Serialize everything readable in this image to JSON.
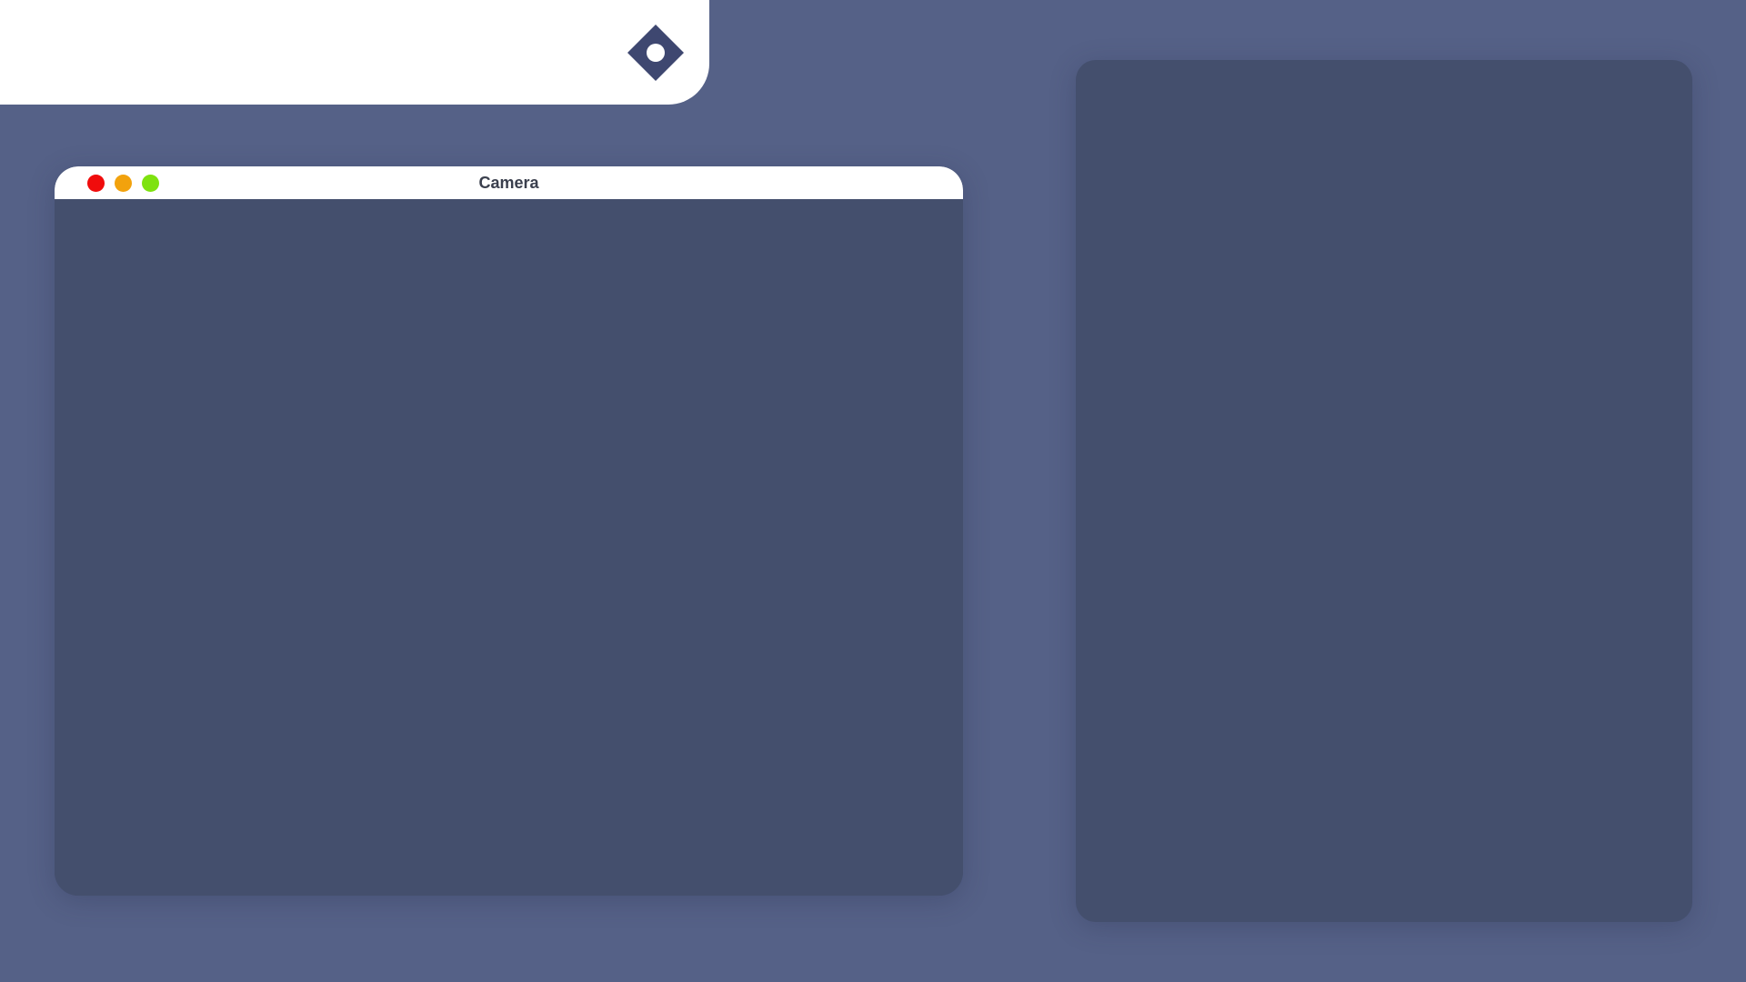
{
  "header": {
    "logo_icon": "diamond-eye-logo-icon"
  },
  "camera_window": {
    "title": "Camera",
    "controls": {
      "close": {
        "icon": "close-dot-icon",
        "color": "#f00c0c"
      },
      "minimize": {
        "icon": "minimize-dot-icon",
        "color": "#f2a20d"
      },
      "maximize": {
        "icon": "maximize-dot-icon",
        "color": "#7ee20f"
      }
    }
  },
  "colors": {
    "background": "#556187",
    "panel": "#444f6d",
    "header": "#ffffff",
    "logo": "#3e4770"
  }
}
